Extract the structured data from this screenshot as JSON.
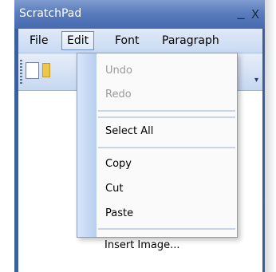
{
  "window": {
    "title": "ScratchPad",
    "minimize_label": "_",
    "close_label": "X"
  },
  "menubar": {
    "items": [
      {
        "label": "File"
      },
      {
        "label": "Edit"
      },
      {
        "label": "Font"
      },
      {
        "label": "Paragraph"
      }
    ]
  },
  "toolbar": {
    "overflow_icon": "chevron-down-icon",
    "overflow_label": "▾"
  },
  "edit_menu": {
    "items": [
      {
        "label": "Undo",
        "enabled": false
      },
      {
        "label": "Redo",
        "enabled": false
      },
      {
        "label": "Select All",
        "enabled": true
      },
      {
        "label": "Copy",
        "enabled": true
      },
      {
        "label": "Cut",
        "enabled": true
      },
      {
        "label": "Paste",
        "enabled": true
      },
      {
        "label": "Insert Image...",
        "enabled": true
      }
    ]
  },
  "colors": {
    "title_bar": "#476ab0",
    "menu_highlight": "#6e8ec3",
    "gutter": "#b7cdf0"
  }
}
